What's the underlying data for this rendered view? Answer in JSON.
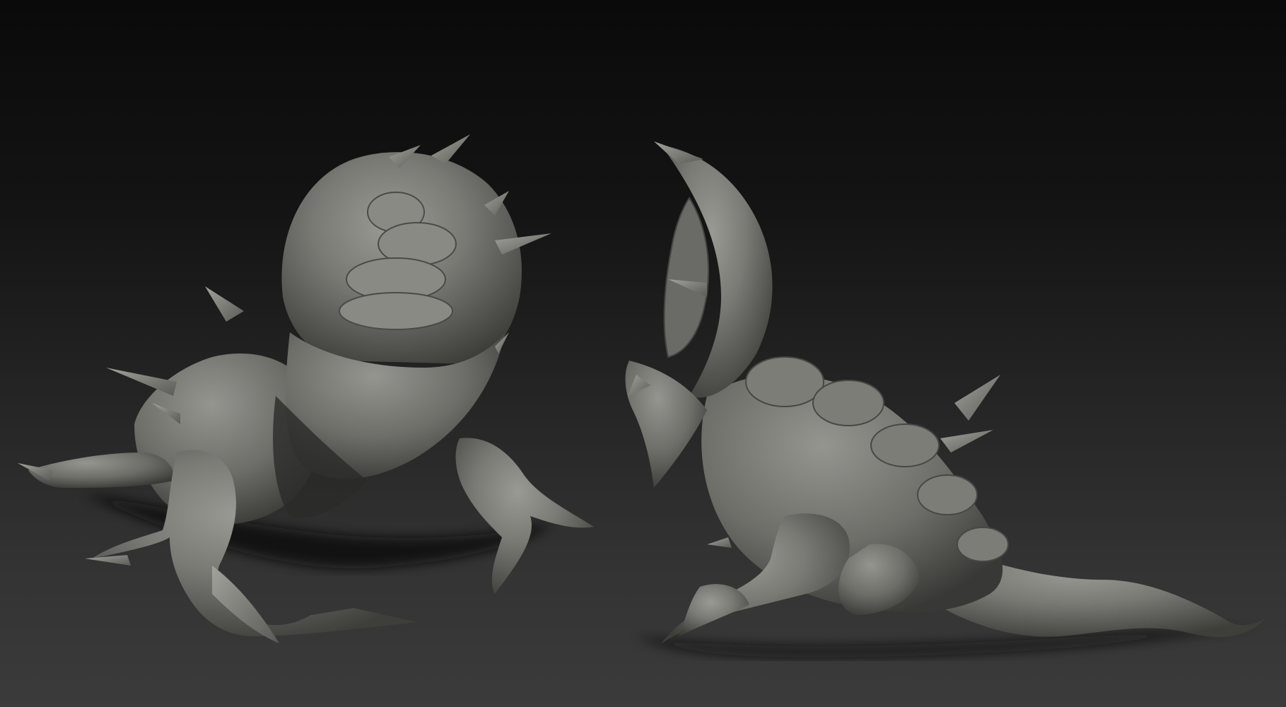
{
  "scene": {
    "background_top": "#0a0a0a",
    "background_bottom": "#3b3b3b",
    "clay_light": "#8c8c87",
    "clay_mid": "#6b6b67",
    "clay_dark": "#3c3c3a",
    "shadow": "#0d0d0d"
  },
  "models": [
    {
      "name": "creature-front-view"
    },
    {
      "name": "creature-side-view"
    }
  ]
}
